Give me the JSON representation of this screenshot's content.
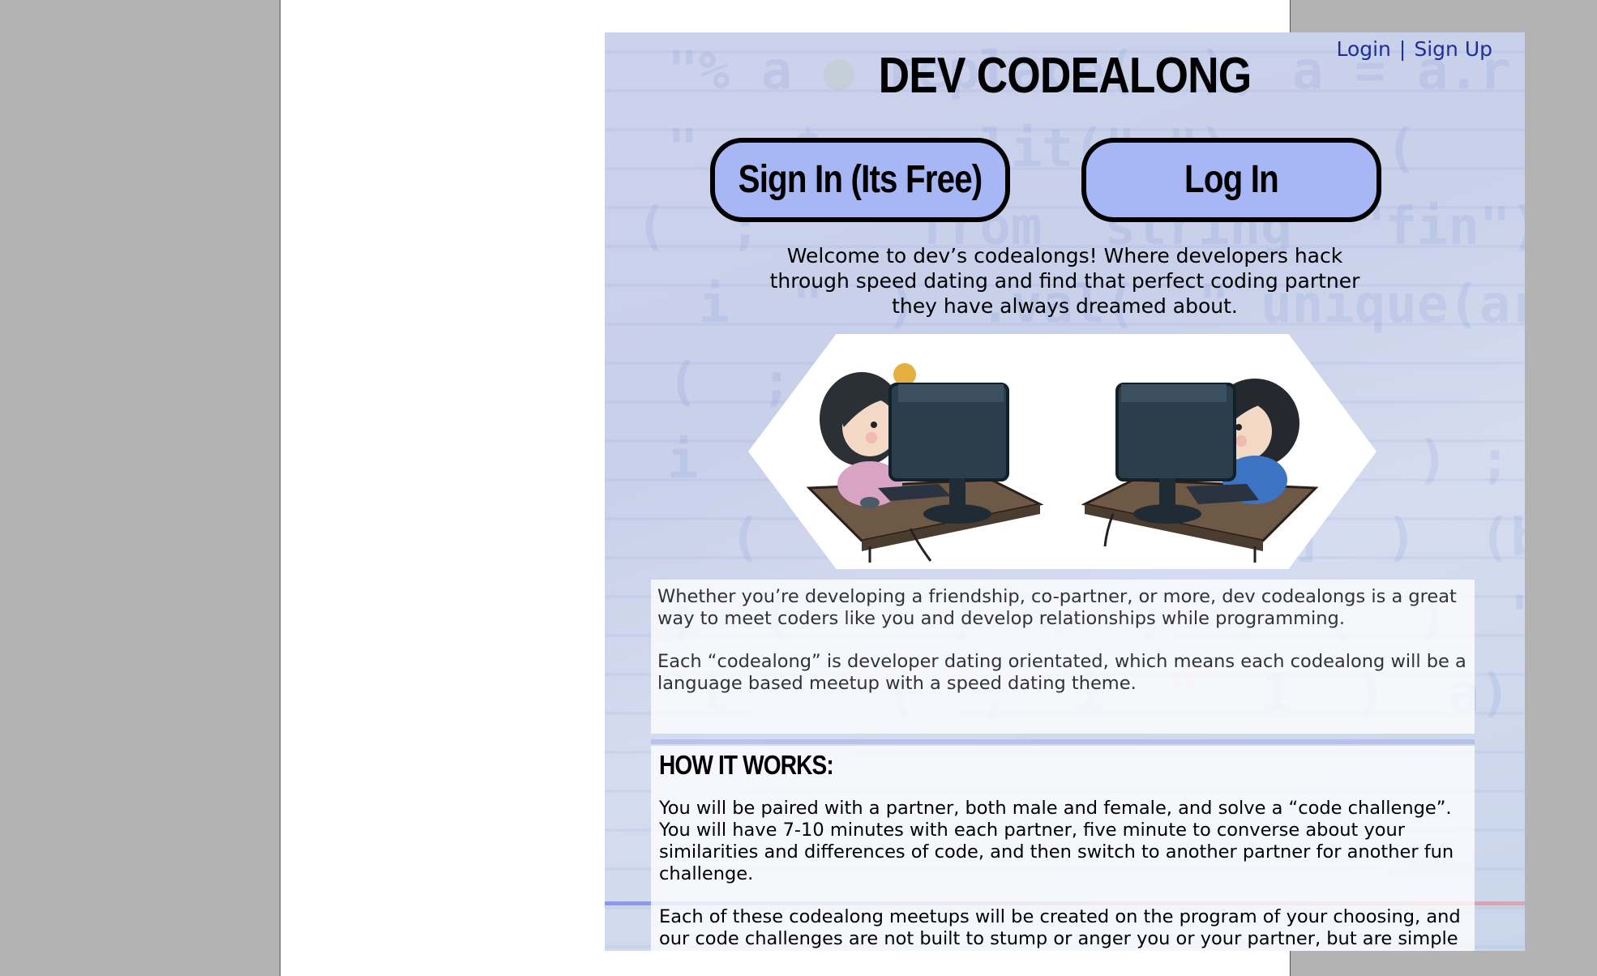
{
  "header": {
    "login_link": "Login",
    "separator": "|",
    "signup_link": "Sign Up",
    "brand_title": "DEV CODEALONG"
  },
  "cta": {
    "signin_label": "Sign In (Its Free)",
    "login_label": "Log In"
  },
  "welcome": {
    "line1": "Welcome to dev’s codealongs! Where developers hack",
    "line2": "through speed dating and find that perfect coding partner",
    "line3": "they have always dreamed about."
  },
  "intro": {
    "paragraph1": "Whether you’re developing a friendship, co-partner, or more, dev codealongs is a great way to meet coders like you and develop relationships while programming.",
    "paragraph2": "Each “codealong” is developer dating orientated, which means each codealong will be a language based meetup with a speed dating theme."
  },
  "how_it_works": {
    "heading": "HOW IT WORKS:",
    "paragraph1": "You will be paired with a partner, both male and female, and solve a “code challenge”. You will have 7-10 minutes with each partner, five minute to converse about your similarities and differences of code, and then switch to another partner for another fun challenge.",
    "paragraph2": "Each of these codealong meetups will be created on the program of your choosing, and our code challenges are not built to stump or anger you or your partner, but are simple fun challenges built for coders with all types of experience."
  },
  "colors": {
    "button_fill": "#a7b6f4",
    "link": "#1e2f9a",
    "page_gutter": "#b3b3b3"
  },
  "icons": {
    "illustration": "two-coders-at-computers-illustration"
  }
}
